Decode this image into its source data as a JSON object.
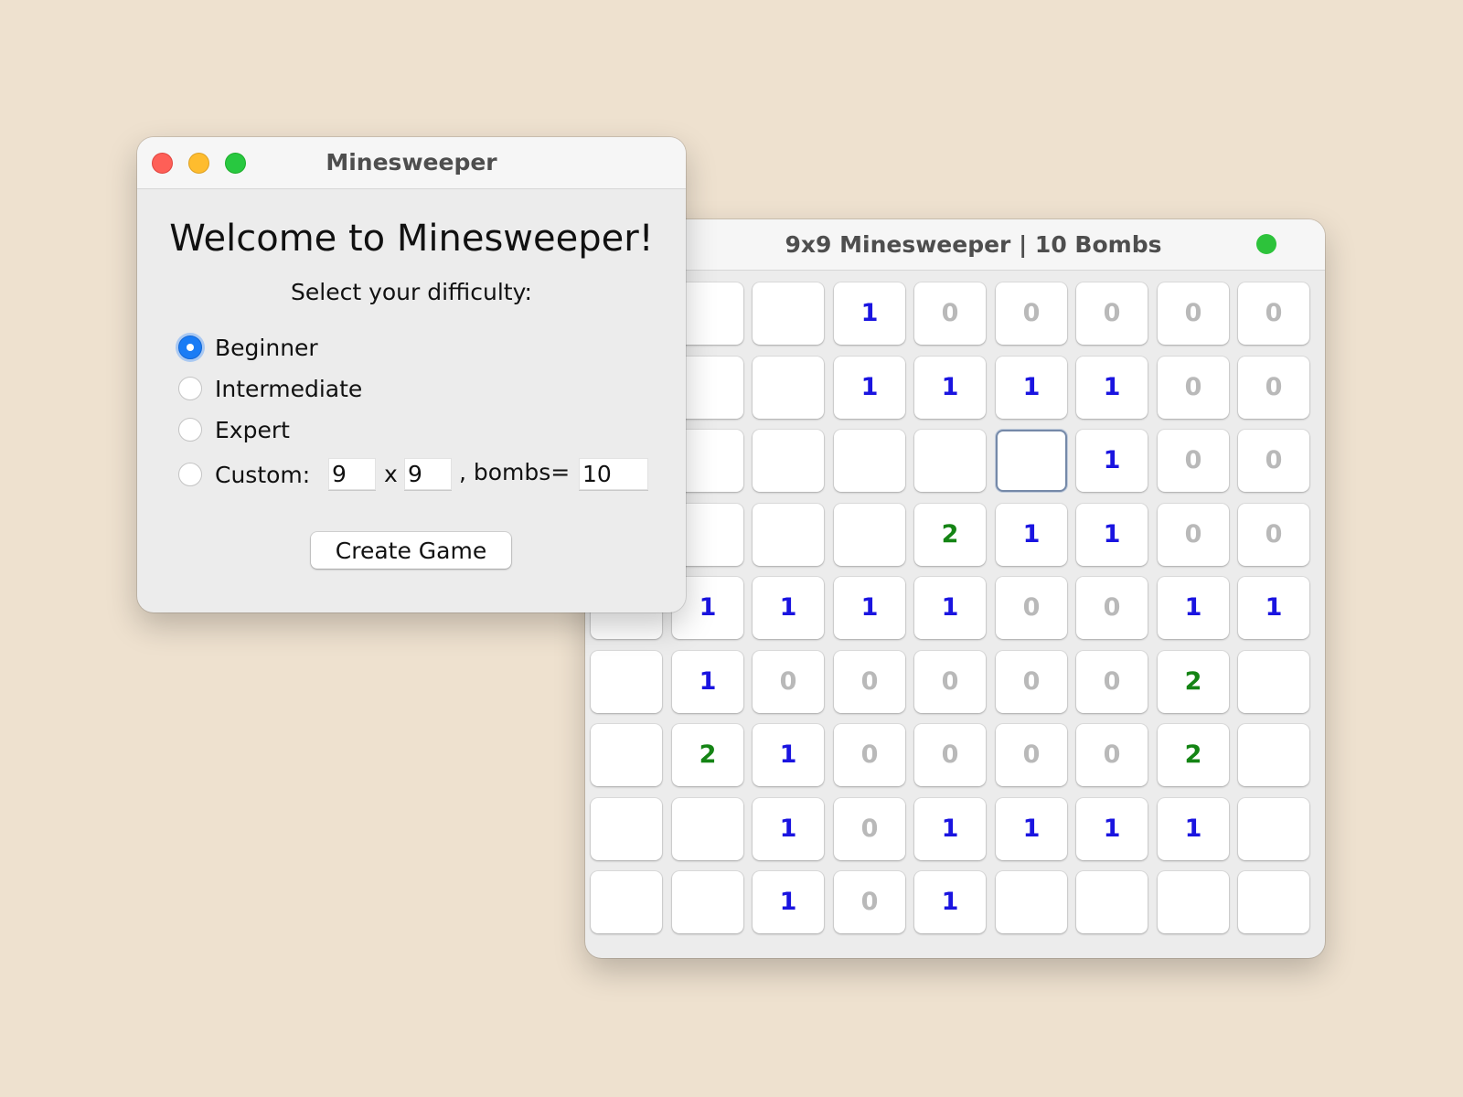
{
  "dialog": {
    "title": "Minesweeper",
    "heading": "Welcome to Minesweeper!",
    "prompt": "Select your difficulty:",
    "options": [
      {
        "label": "Beginner",
        "selected": true
      },
      {
        "label": "Intermediate",
        "selected": false
      },
      {
        "label": "Expert",
        "selected": false
      },
      {
        "label": "Custom:",
        "selected": false
      }
    ],
    "custom": {
      "rows": "9",
      "separator": "x",
      "cols": "9",
      "bombs_label": ", bombs=",
      "bombs": "10"
    },
    "create_button": "Create Game"
  },
  "game": {
    "title": "9x9 Minesweeper | 10 Bombs",
    "board": [
      [
        "",
        "",
        "",
        "1",
        "0",
        "0",
        "0",
        "0",
        "0"
      ],
      [
        "",
        "",
        "",
        "1",
        "1",
        "1",
        "1",
        "0",
        "0"
      ],
      [
        "",
        "",
        "",
        "",
        "",
        "",
        "1",
        "0",
        "0"
      ],
      [
        "",
        "",
        "",
        "",
        "2",
        "1",
        "1",
        "0",
        "0"
      ],
      [
        "",
        "1",
        "1",
        "1",
        "1",
        "0",
        "0",
        "1",
        "1"
      ],
      [
        "",
        "1",
        "0",
        "0",
        "0",
        "0",
        "0",
        "2",
        ""
      ],
      [
        "",
        "2",
        "1",
        "0",
        "0",
        "0",
        "0",
        "2",
        ""
      ],
      [
        "",
        "",
        "1",
        "0",
        "1",
        "1",
        "1",
        "1",
        ""
      ],
      [
        "",
        "",
        "1",
        "0",
        "1",
        "",
        "",
        "",
        ""
      ]
    ],
    "focused_cell": {
      "row": 2,
      "col": 5
    },
    "number_colors": {
      "0": "#b9b9b9",
      "1": "#1a14e0",
      "2": "#148414"
    }
  }
}
